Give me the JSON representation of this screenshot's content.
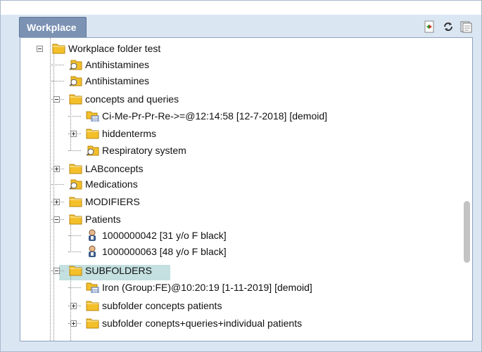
{
  "tab": {
    "title": "Workplace"
  },
  "toolbar": {
    "icons": [
      "export-icon",
      "refresh-icon",
      "notes-icon"
    ]
  },
  "tree": [
    {
      "label": "Workplace folder test",
      "type": "folder",
      "expander": "minus"
    },
    {
      "label": "Antihistamines",
      "type": "concept-folder"
    },
    {
      "label": "Antihistamines",
      "type": "concept-folder"
    },
    {
      "label": "concepts and queries",
      "type": "folder",
      "expander": "minus"
    },
    {
      "label": "Ci-Me-Pr-Pr-Re->=@12:14:58 [12-7-2018] [demoid]",
      "type": "query-folder"
    },
    {
      "label": "hiddenterms",
      "type": "folder",
      "expander": "plus"
    },
    {
      "label": "Respiratory system",
      "type": "concept-folder"
    },
    {
      "label": "LABconcepts",
      "type": "folder",
      "expander": "plus"
    },
    {
      "label": "Medications",
      "type": "concept-folder"
    },
    {
      "label": "MODIFIERS",
      "type": "folder",
      "expander": "plus"
    },
    {
      "label": "Patients",
      "type": "folder",
      "expander": "minus"
    },
    {
      "label": "1000000042 [31 y/o F black]",
      "type": "patient"
    },
    {
      "label": "1000000063 [48 y/o F black]",
      "type": "patient"
    },
    {
      "label": "SUBFOLDERS",
      "type": "folder",
      "expander": "minus",
      "selected": true
    },
    {
      "label": "Iron (Group:FE)@10:20:19 [1-11-2019] [demoid]",
      "type": "query-folder"
    },
    {
      "label": "subfolder concepts patients",
      "type": "folder",
      "expander": "plus"
    },
    {
      "label": "subfolder conepts+queries+individual patients",
      "type": "folder",
      "expander": "plus"
    }
  ],
  "colors": {
    "tab_bg": "#7b92b3",
    "frame_bg": "#dbe6f3",
    "folder": "#f4c02a",
    "selected": "#c4e0e0"
  }
}
